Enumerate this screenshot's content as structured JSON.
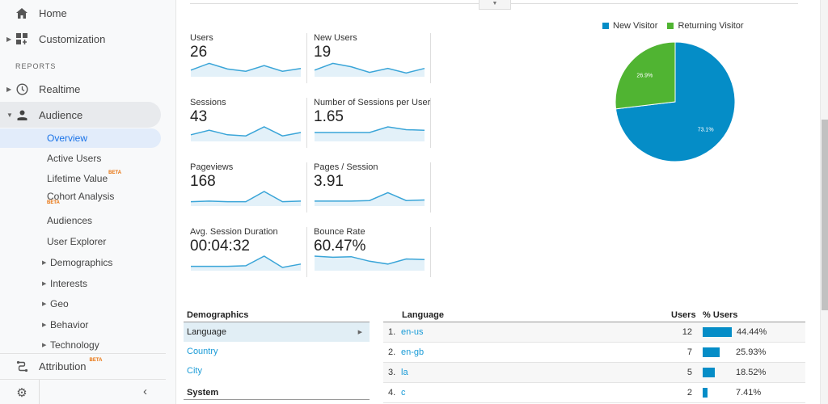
{
  "sidebar": {
    "home": "Home",
    "customization": "Customization",
    "reports_label": "REPORTS",
    "realtime": "Realtime",
    "audience": "Audience",
    "sub_items": [
      {
        "label": "Overview"
      },
      {
        "label": "Active Users"
      },
      {
        "label": "Lifetime Value",
        "badge": "BETA"
      },
      {
        "label": "Cohort Analysis",
        "badge": "BETA"
      },
      {
        "label": "Audiences"
      },
      {
        "label": "User Explorer"
      },
      {
        "label": "Demographics"
      },
      {
        "label": "Interests"
      },
      {
        "label": "Geo"
      },
      {
        "label": "Behavior"
      },
      {
        "label": "Technology"
      }
    ],
    "attribution": "Attribution",
    "attribution_badge": "BETA"
  },
  "metrics": [
    {
      "label": "Users",
      "value": "26",
      "trend": [
        0.3,
        0.9,
        0.4,
        0.2,
        0.7,
        0.2,
        0.45
      ]
    },
    {
      "label": "New Users",
      "value": "19",
      "trend": [
        0.3,
        0.9,
        0.6,
        0.1,
        0.45,
        0.05,
        0.45
      ]
    },
    {
      "label": "Sessions",
      "value": "43",
      "trend": [
        0.3,
        0.7,
        0.3,
        0.2,
        1.0,
        0.2,
        0.5
      ]
    },
    {
      "label": "Number of Sessions per User",
      "value": "1.65",
      "trend": [
        0.5,
        0.5,
        0.5,
        0.5,
        1.0,
        0.75,
        0.7
      ]
    },
    {
      "label": "Pageviews",
      "value": "168",
      "trend": [
        0.1,
        0.15,
        0.1,
        0.1,
        1.0,
        0.1,
        0.15
      ]
    },
    {
      "label": "Pages / Session",
      "value": "3.91",
      "trend": [
        0.15,
        0.15,
        0.15,
        0.2,
        0.9,
        0.2,
        0.25
      ]
    },
    {
      "label": "Avg. Session Duration",
      "value": "00:04:32",
      "trend": [
        0.1,
        0.1,
        0.1,
        0.15,
        1.0,
        0.0,
        0.3
      ]
    },
    {
      "label": "Bounce Rate",
      "value": "60.47%",
      "trend": [
        1.0,
        0.9,
        0.95,
        0.55,
        0.3,
        0.75,
        0.7
      ]
    }
  ],
  "chart_data": {
    "type": "pie",
    "legend": [
      "New Visitor",
      "Returning Visitor"
    ],
    "slices": [
      {
        "label": "New Visitor",
        "value": 73.1,
        "display": "73.1%",
        "color": "#058dc7"
      },
      {
        "label": "Returning Visitor",
        "value": 26.9,
        "display": "26.9%",
        "color": "#50b432"
      }
    ],
    "legend_position": "top"
  },
  "demographics": {
    "heading": "Demographics",
    "items": [
      "Language",
      "Country",
      "City"
    ],
    "system_heading": "System"
  },
  "language_table": {
    "headers": {
      "dimension": "Language",
      "users": "Users",
      "pct_users": "% Users"
    },
    "rows": [
      {
        "idx": "1.",
        "lang": "en-us",
        "users": "12",
        "pct": "44.44%",
        "fraction": 0.4444
      },
      {
        "idx": "2.",
        "lang": "en-gb",
        "users": "7",
        "pct": "25.93%",
        "fraction": 0.2593
      },
      {
        "idx": "3.",
        "lang": "la",
        "users": "5",
        "pct": "18.52%",
        "fraction": 0.1852
      },
      {
        "idx": "4.",
        "lang": "c",
        "users": "2",
        "pct": "7.41%",
        "fraction": 0.0741
      }
    ]
  },
  "colors": {
    "accent": "#058dc7",
    "secondary": "#50b432",
    "link": "#1a9bd7",
    "beta": "#e8710a"
  }
}
